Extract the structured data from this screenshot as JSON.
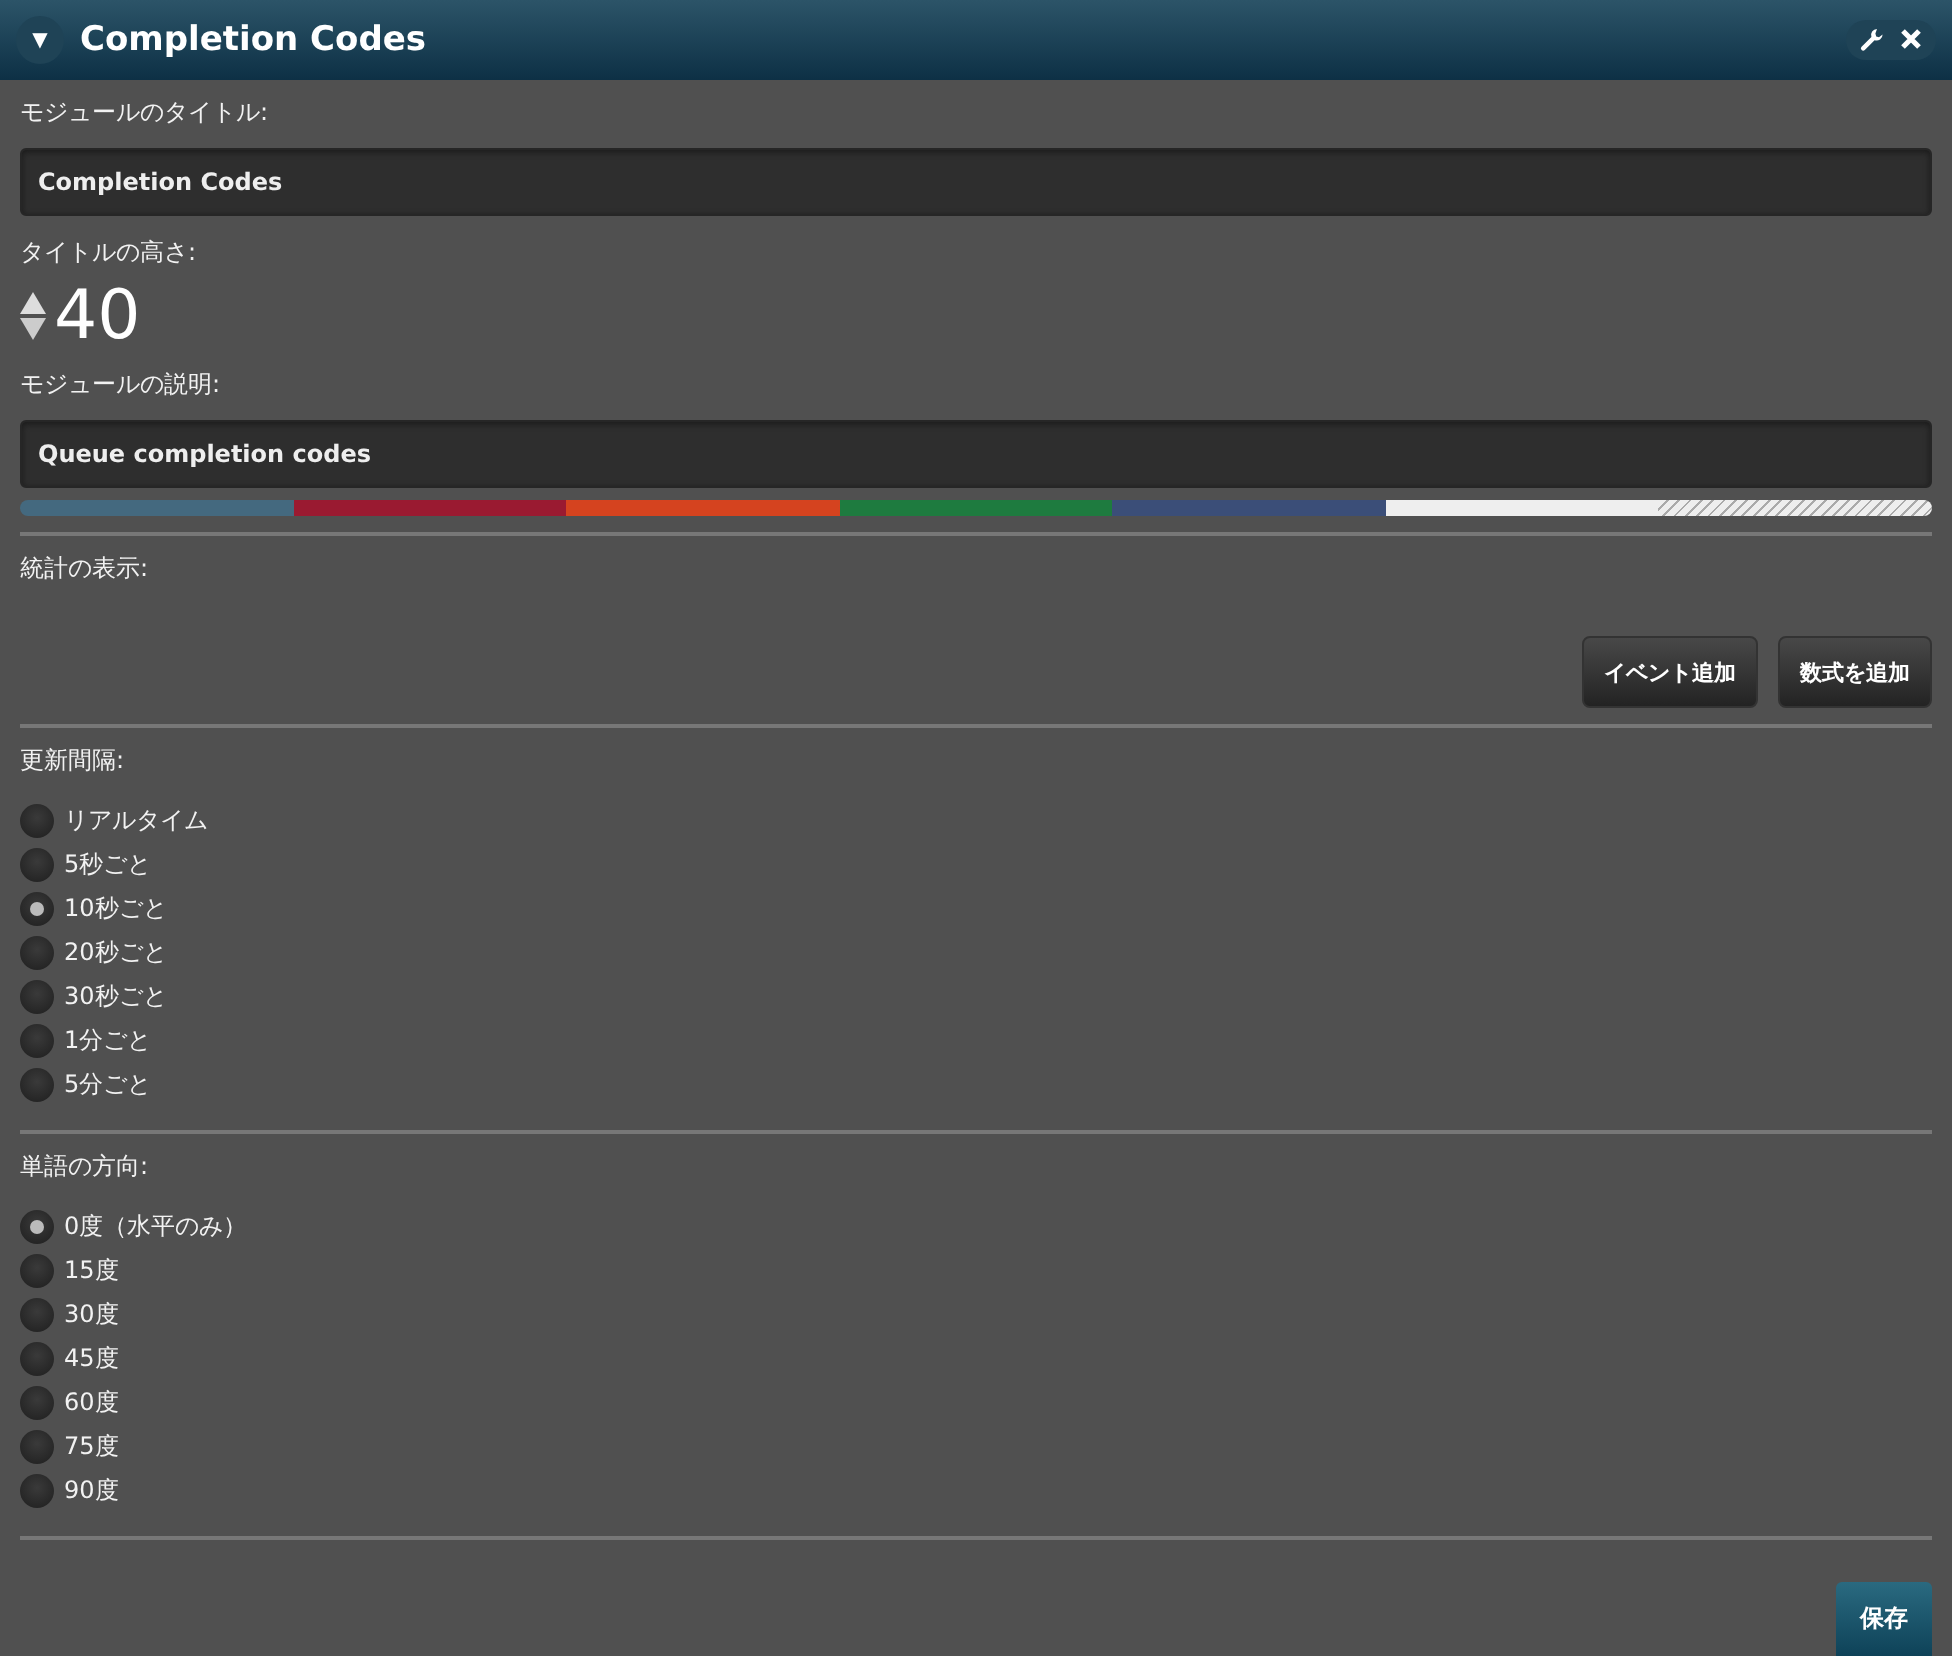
{
  "window": {
    "title": "Completion Codes",
    "collapse_glyph": "▼"
  },
  "module_title": {
    "label": "モジュールのタイトル:",
    "value": "Completion Codes"
  },
  "title_height": {
    "label": "タイトルの高さ:",
    "value": "40"
  },
  "module_description": {
    "label": "モジュールの説明:",
    "value": "Queue completion codes"
  },
  "color_palette": [
    {
      "kind": "solid",
      "color": "#44697f"
    },
    {
      "kind": "solid",
      "color": "#9a1a31"
    },
    {
      "kind": "solid",
      "color": "#d5431f"
    },
    {
      "kind": "solid",
      "color": "#1e7b3f"
    },
    {
      "kind": "solid",
      "color": "#3b4e78"
    },
    {
      "kind": "solid",
      "color": "#eeeeee"
    },
    {
      "kind": "hatched",
      "color": "#eeeeee"
    }
  ],
  "statistics": {
    "label": "統計の表示:",
    "buttons": [
      "イベント追加",
      "数式を追加"
    ]
  },
  "refresh_interval": {
    "label": "更新間隔:",
    "options": [
      {
        "label": "リアルタイム",
        "selected": false
      },
      {
        "label": "5秒ごと",
        "selected": false
      },
      {
        "label": "10秒ごと",
        "selected": true
      },
      {
        "label": "20秒ごと",
        "selected": false
      },
      {
        "label": "30秒ごと",
        "selected": false
      },
      {
        "label": "1分ごと",
        "selected": false
      },
      {
        "label": "5分ごと",
        "selected": false
      }
    ]
  },
  "word_orientation": {
    "label": "単語の方向:",
    "options": [
      {
        "label": "0度（水平のみ）",
        "selected": true
      },
      {
        "label": "15度",
        "selected": false
      },
      {
        "label": "30度",
        "selected": false
      },
      {
        "label": "45度",
        "selected": false
      },
      {
        "label": "60度",
        "selected": false
      },
      {
        "label": "75度",
        "selected": false
      },
      {
        "label": "90度",
        "selected": false
      }
    ]
  },
  "save_button": "保存"
}
